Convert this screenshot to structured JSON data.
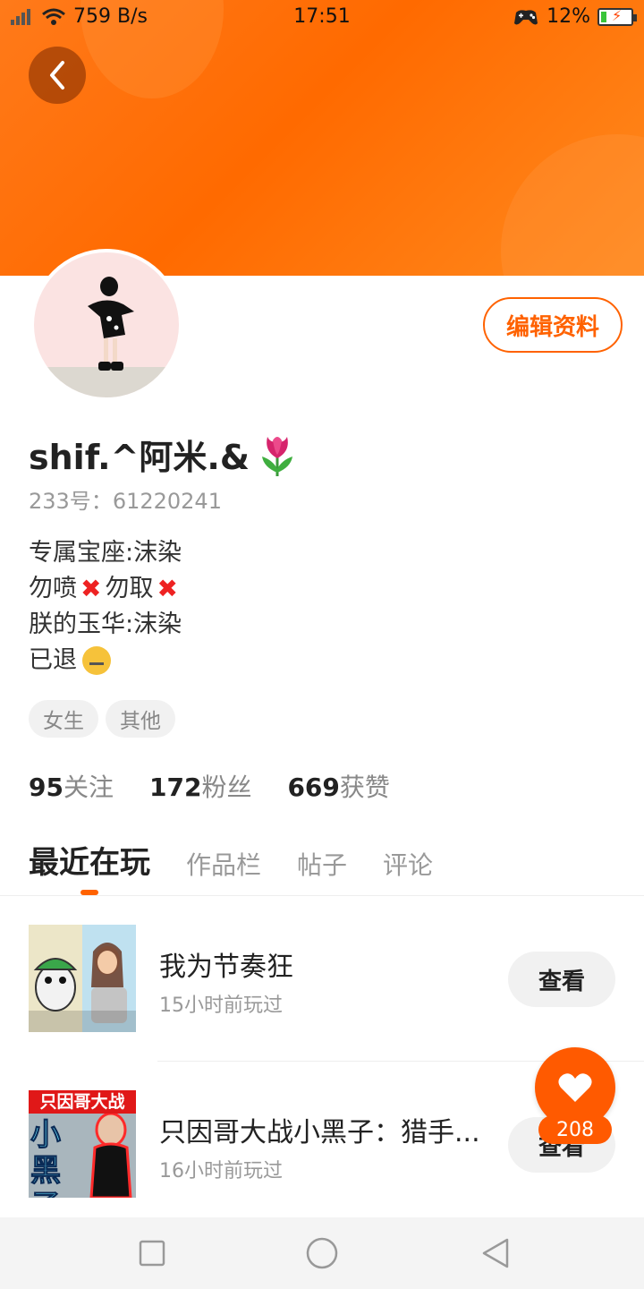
{
  "status_bar": {
    "network_speed": "759 B/s",
    "time": "17:51",
    "battery": "12%"
  },
  "profile": {
    "edit_label": "编辑资料",
    "name": "shif.^阿米.&",
    "uid_label": "233号：",
    "uid": "61220241",
    "bio": {
      "line1": "专属宝座:沫染",
      "line2_a": "勿喷",
      "line2_b": "勿取",
      "line3": "朕的玉华:沫染",
      "line4": "已退"
    },
    "tags": [
      "女生",
      "其他"
    ],
    "stats": [
      {
        "num": "95",
        "label": "关注"
      },
      {
        "num": "172",
        "label": "粉丝"
      },
      {
        "num": "669",
        "label": "获赞"
      }
    ]
  },
  "tabs": [
    "最近在玩",
    "作品栏",
    "帖子",
    "评论"
  ],
  "games": [
    {
      "title": "我为节奏狂",
      "time": "15小时前玩过",
      "action": "查看"
    },
    {
      "title": "只因哥大战小黑子：猎手...",
      "time": "16小时前玩过",
      "action": "查看",
      "thumb_text_top": "只因哥大战",
      "thumb_text_big": "小黑子"
    }
  ],
  "like_count": "208",
  "colors": {
    "accent": "#ff6200",
    "banner": "#ff7a1a"
  }
}
